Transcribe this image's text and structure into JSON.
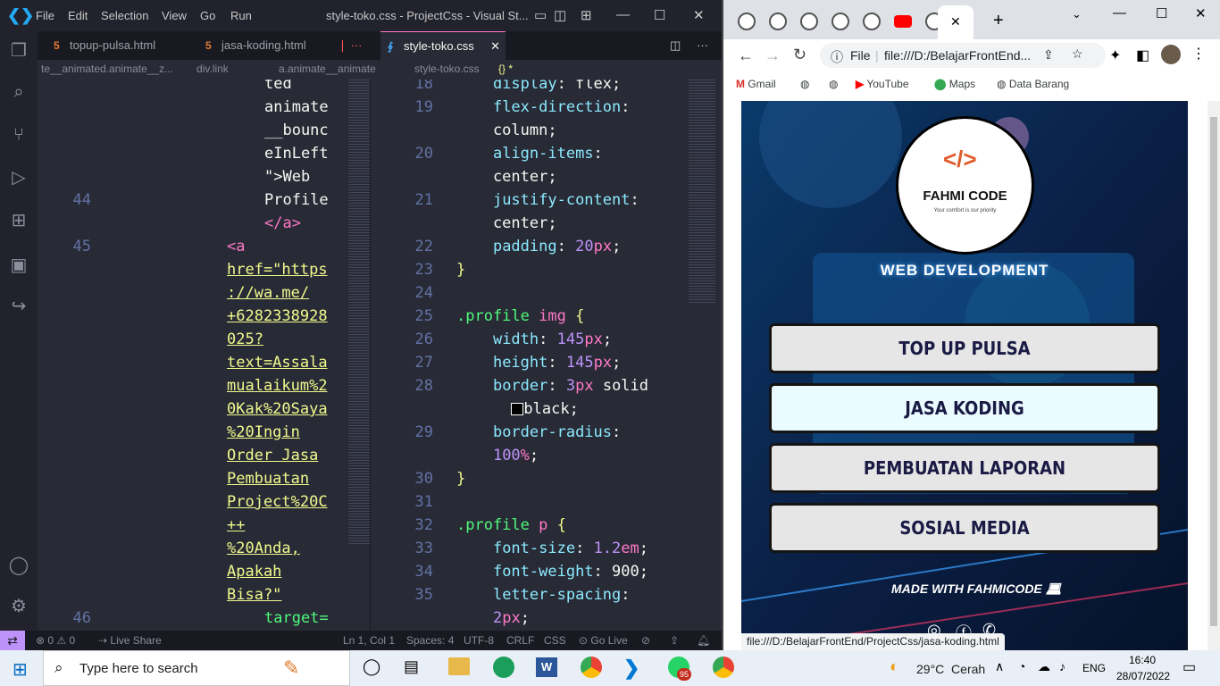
{
  "vscode": {
    "menu": [
      "File",
      "Edit",
      "Selection",
      "View",
      "Go",
      "Run"
    ],
    "title": "style-toko.css - ProjectCss - Visual St...",
    "tabs": [
      {
        "label": "topup-pulsa.html",
        "icon": "html-file-icon"
      },
      {
        "label": "jasa-koding.html",
        "icon": "html-file-icon"
      },
      {
        "label": "style-toko.css",
        "icon": "css-file-icon",
        "active": true
      }
    ],
    "breadcrumb_left": [
      "te__animated.animate__z...",
      "div.link",
      "a.animate__animate"
    ],
    "breadcrumb_right": [
      "style-toko.css",
      "{} *"
    ],
    "left_code": [
      {
        "n": "",
        "t": "ted"
      },
      {
        "n": "",
        "t": "animate"
      },
      {
        "n": "",
        "t": "__bounc"
      },
      {
        "n": "",
        "t": "eInLeft"
      },
      {
        "n": "",
        "t": "\">Web"
      },
      {
        "n": "44",
        "t": "Profile"
      },
      {
        "n": "",
        "t": "</a>"
      },
      {
        "n": "45",
        "t": "<a"
      },
      {
        "n": "",
        "t": "href=\"https"
      },
      {
        "n": "",
        "t": "://wa.me/"
      },
      {
        "n": "",
        "t": "+6282338928"
      },
      {
        "n": "",
        "t": "025?"
      },
      {
        "n": "",
        "t": "text=Assala"
      },
      {
        "n": "",
        "t": "mualaikum%2"
      },
      {
        "n": "",
        "t": "0Kak%20Saya"
      },
      {
        "n": "",
        "t": "%20Ingin"
      },
      {
        "n": "",
        "t": "Order Jasa"
      },
      {
        "n": "",
        "t": "Pembuatan"
      },
      {
        "n": "",
        "t": "Project%20C"
      },
      {
        "n": "",
        "t": "++"
      },
      {
        "n": "",
        "t": "%20Anda,"
      },
      {
        "n": "",
        "t": "Apakah"
      },
      {
        "n": "",
        "t": "Bisa?\""
      },
      {
        "n": "46",
        "t": "target="
      }
    ],
    "right_code": [
      {
        "n": "18",
        "t": "    display: flex;"
      },
      {
        "n": "19",
        "t": "    flex-direction:"
      },
      {
        "n": "",
        "t": "    column;"
      },
      {
        "n": "20",
        "t": "    align-items:"
      },
      {
        "n": "",
        "t": "    center;"
      },
      {
        "n": "21",
        "t": "    justify-content:"
      },
      {
        "n": "",
        "t": "    center;"
      },
      {
        "n": "22",
        "t": "    padding: 20px;"
      },
      {
        "n": "23",
        "t": "}"
      },
      {
        "n": "24",
        "t": ""
      },
      {
        "n": "25",
        "t": ".profile img {"
      },
      {
        "n": "26",
        "t": "    width: 145px;"
      },
      {
        "n": "27",
        "t": "    height: 145px;"
      },
      {
        "n": "28",
        "t": "    border: 3px solid"
      },
      {
        "n": "",
        "t": "      black;"
      },
      {
        "n": "29",
        "t": "    border-radius:"
      },
      {
        "n": "",
        "t": "    100%;"
      },
      {
        "n": "30",
        "t": "}"
      },
      {
        "n": "31",
        "t": ""
      },
      {
        "n": "32",
        "t": ".profile p {"
      },
      {
        "n": "33",
        "t": "    font-size: 1.2em;"
      },
      {
        "n": "34",
        "t": "    font-weight: 900;"
      },
      {
        "n": "35",
        "t": "    letter-spacing:"
      },
      {
        "n": "",
        "t": "    2px;"
      }
    ],
    "status": {
      "errors": "0",
      "warnings": "0",
      "live_share": "Live Share",
      "position": "Ln 1, Col 1",
      "spaces": "Spaces: 4",
      "encoding": "UTF-8",
      "eol": "CRLF",
      "lang": "CSS",
      "golive": "Go Live"
    }
  },
  "chrome": {
    "url": "file:///D:/BelajarFrontEnd...",
    "url_prefix": "File",
    "bookmarks": [
      "Gmail",
      "YouTube",
      "Maps",
      "Data Barang"
    ],
    "status_link": "file:///D:/BelajarFrontEnd/ProjectCss/jasa-koding.html",
    "page": {
      "logo_title": "FAHMI CODE",
      "logo_sub": "Your comfort is our priority",
      "banner": "WEB DEVELOPMENT",
      "buttons": [
        "TOP UP PULSA",
        "JASA KODING",
        "PEMBUATAN LAPORAN",
        "SOSIAL MEDIA"
      ],
      "footer": "MADE WITH FAHMICODE"
    }
  },
  "taskbar": {
    "search_placeholder": "Type here to search",
    "weather": "29°C  Cerah",
    "lang": "ENG",
    "time": "16:40",
    "date": "28/07/2022",
    "whatsapp_badge": "95"
  }
}
